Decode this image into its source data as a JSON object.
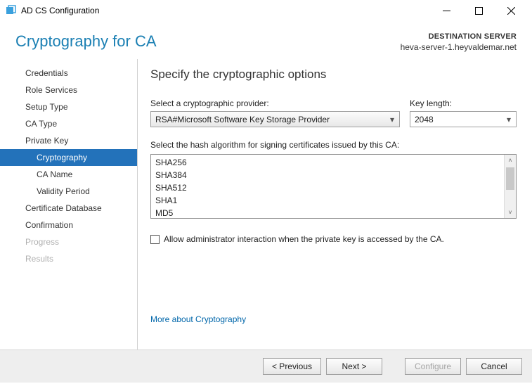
{
  "window": {
    "title": "AD CS Configuration"
  },
  "header": {
    "page_title": "Cryptography for CA",
    "destination_label": "DESTINATION SERVER",
    "destination_value": "heva-server-1.heyvaldemar.net"
  },
  "sidebar": {
    "items": [
      {
        "label": "Credentials",
        "indent": false
      },
      {
        "label": "Role Services",
        "indent": false
      },
      {
        "label": "Setup Type",
        "indent": false
      },
      {
        "label": "CA Type",
        "indent": false
      },
      {
        "label": "Private Key",
        "indent": false
      },
      {
        "label": "Cryptography",
        "indent": true,
        "selected": true
      },
      {
        "label": "CA Name",
        "indent": true
      },
      {
        "label": "Validity Period",
        "indent": true
      },
      {
        "label": "Certificate Database",
        "indent": false
      },
      {
        "label": "Confirmation",
        "indent": false
      },
      {
        "label": "Progress",
        "indent": false,
        "disabled": true
      },
      {
        "label": "Results",
        "indent": false,
        "disabled": true
      }
    ]
  },
  "content": {
    "heading": "Specify the cryptographic options",
    "provider_label": "Select a cryptographic provider:",
    "provider_value": "RSA#Microsoft Software Key Storage Provider",
    "keylen_label": "Key length:",
    "keylen_value": "2048",
    "hash_label": "Select the hash algorithm for signing certificates issued by this CA:",
    "hash_options": [
      "SHA256",
      "SHA384",
      "SHA512",
      "SHA1",
      "MD5"
    ],
    "checkbox_label": "Allow administrator interaction when the private key is accessed by the CA.",
    "link_text": "More about Cryptography"
  },
  "footer": {
    "previous": "< Previous",
    "next": "Next >",
    "configure": "Configure",
    "cancel": "Cancel"
  }
}
